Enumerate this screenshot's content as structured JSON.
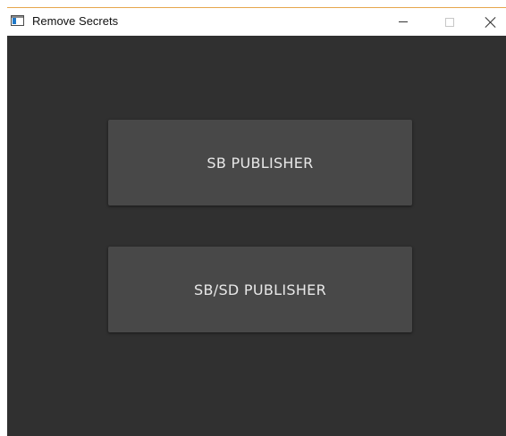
{
  "window": {
    "title": "Remove Secrets",
    "controls": {
      "minimize": "minimize",
      "maximize": "maximize",
      "close": "close"
    }
  },
  "buttons": {
    "sb_publisher": "SB PUBLISHER",
    "sbsd_publisher": "SB/SD PUBLISHER"
  },
  "colors": {
    "content_background": "#303030",
    "button_background": "#484848",
    "button_text": "#e8e8e8",
    "window_accent_border": "#e6a64c"
  }
}
